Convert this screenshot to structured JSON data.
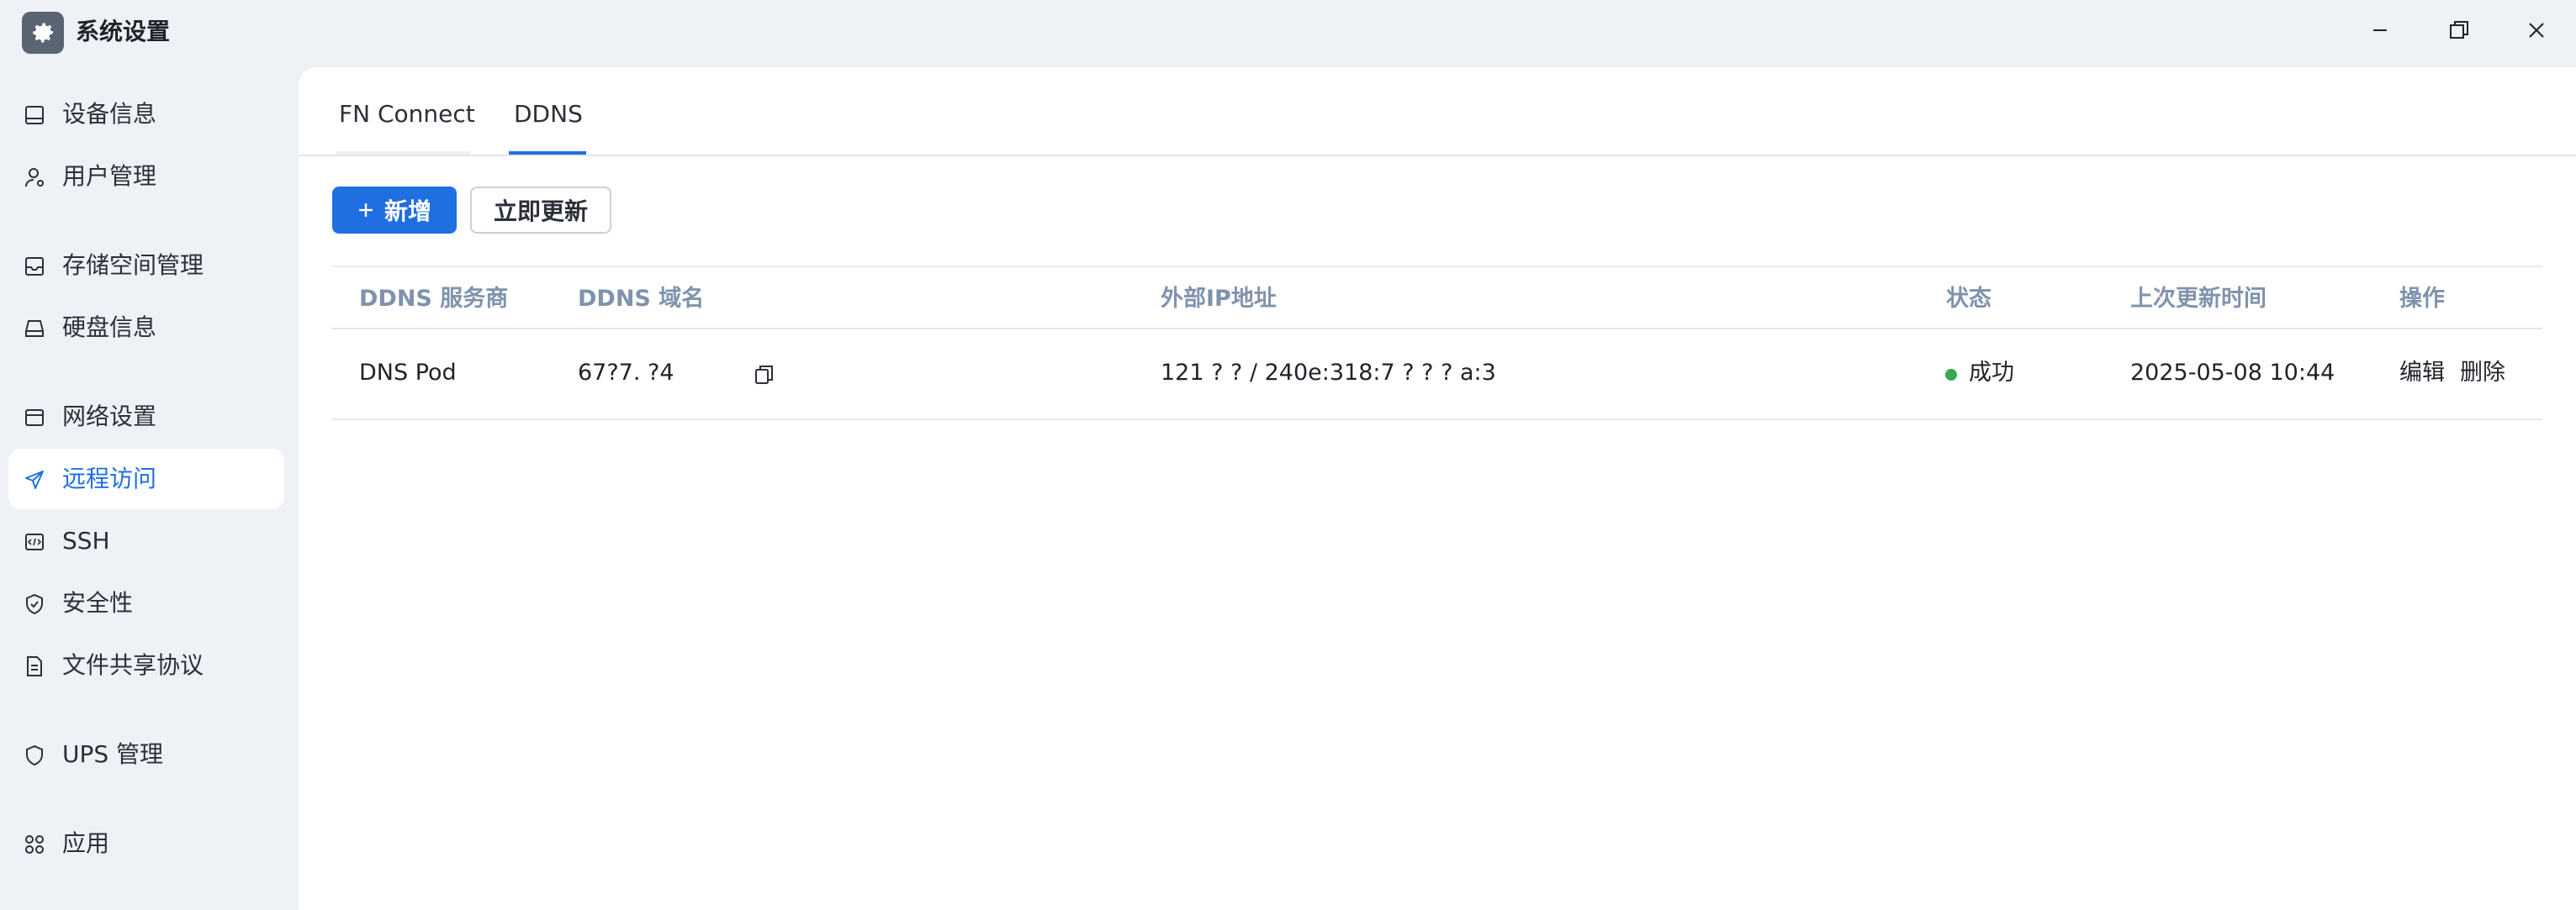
{
  "window": {
    "title": "系统设置",
    "controls": [
      "minimize",
      "maximize",
      "close"
    ]
  },
  "sidebar": {
    "items": [
      {
        "label": "设备信息",
        "icon": "device-icon"
      },
      {
        "label": "用户管理",
        "icon": "user-icon"
      },
      {
        "label": "存储空间管理",
        "icon": "storage-icon"
      },
      {
        "label": "硬盘信息",
        "icon": "disk-icon"
      },
      {
        "label": "网络设置",
        "icon": "network-icon"
      },
      {
        "label": "远程访问",
        "icon": "send-icon",
        "active": true
      },
      {
        "label": "SSH",
        "icon": "code-icon"
      },
      {
        "label": "安全性",
        "icon": "shield-check-icon"
      },
      {
        "label": "文件共享协议",
        "icon": "document-icon"
      },
      {
        "label": "UPS 管理",
        "icon": "shield-icon"
      },
      {
        "label": "应用",
        "icon": "apps-icon"
      }
    ]
  },
  "tabs": [
    {
      "label": "FN Connect"
    },
    {
      "label": "DDNS",
      "active": true
    }
  ],
  "toolbar": {
    "add_label": "新增",
    "add_icon": "plus-icon",
    "update_label": "立即更新"
  },
  "table": {
    "headers": [
      "DDNS 服务商",
      "DDNS 域名",
      "外部IP地址",
      "状态",
      "上次更新时间",
      "操作"
    ],
    "rows": [
      {
        "provider": "DNS Pod",
        "domain": "67?7.  ?4",
        "ip": "121 ?    ?   / 240e:318:7 ?   ?      ?                  a:3",
        "status": "成功",
        "updated": "2025-05-08 10:44",
        "edit": "编辑",
        "delete": "删除"
      }
    ]
  },
  "colors": {
    "accent": "#1f6fe0",
    "status_success": "#3aa757",
    "header_text": "#7f93ad",
    "sidebar_bg": "#eef1f6"
  }
}
